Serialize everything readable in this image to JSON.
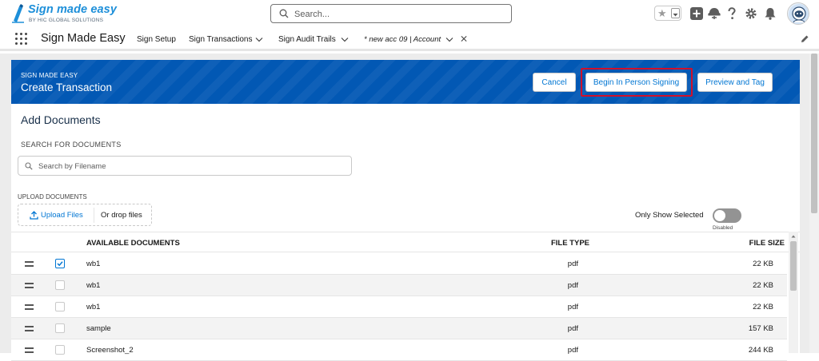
{
  "brand": {
    "title": "Sign made easy",
    "subtitle": "BY HIC GLOBAL SOLUTIONS"
  },
  "global_search": {
    "placeholder": "Search..."
  },
  "app": {
    "name": "Sign Made Easy"
  },
  "nav": {
    "items": [
      {
        "label": "Sign Setup",
        "has_menu": false
      },
      {
        "label": "Sign Transactions",
        "has_menu": true
      },
      {
        "label": "Sign Audit Trails",
        "has_menu": true
      }
    ],
    "active_tab": {
      "label": "* new acc 09 | Account"
    }
  },
  "page": {
    "eyebrow": "SIGN MADE EASY",
    "title": "Create Transaction",
    "buttons": {
      "cancel": "Cancel",
      "begin": "Begin In Person Signing",
      "preview": "Preview and Tag"
    }
  },
  "documents": {
    "section_title": "Add Documents",
    "search_label": "SEARCH FOR DOCUMENTS",
    "search_placeholder": "Search by Filename",
    "upload_label": "UPLOAD DOCUMENTS",
    "upload_button": "Upload Files",
    "drop_text": "Or drop files",
    "toggle": {
      "label": "Only Show Selected",
      "state": "Disabled",
      "on": false
    }
  },
  "table": {
    "columns": {
      "name": "AVAILABLE DOCUMENTS",
      "type": "FILE TYPE",
      "size": "FILE SIZE"
    },
    "rows": [
      {
        "name": "wb1",
        "type": "pdf",
        "size": "22 KB",
        "checked": true
      },
      {
        "name": "wb1",
        "type": "pdf",
        "size": "22 KB",
        "checked": false
      },
      {
        "name": "wb1",
        "type": "pdf",
        "size": "22 KB",
        "checked": false
      },
      {
        "name": "sample",
        "type": "pdf",
        "size": "157 KB",
        "checked": false
      },
      {
        "name": "Screenshot_2",
        "type": "pdf",
        "size": "244 KB",
        "checked": false
      }
    ]
  },
  "colors": {
    "header_blue": "#0258b4",
    "brand_blue": "#0176d3",
    "highlight_red": "#d0102b"
  }
}
